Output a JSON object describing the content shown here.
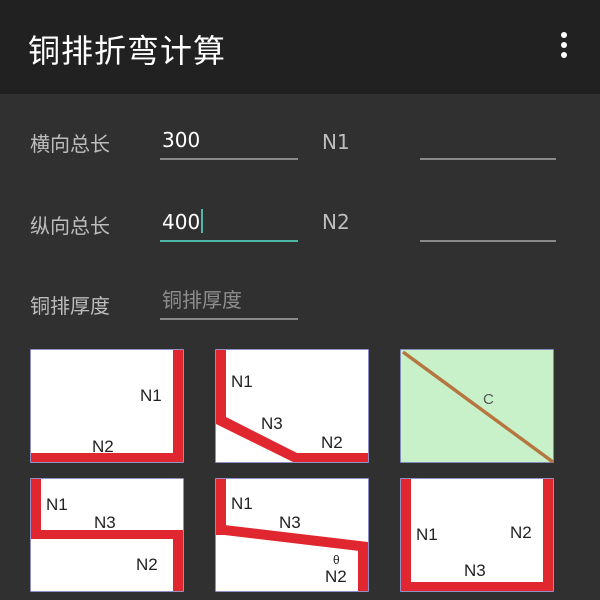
{
  "app": {
    "title": "铜排折弯计算"
  },
  "form": {
    "horizontal_length": {
      "label": "横向总长",
      "value": "300"
    },
    "vertical_length": {
      "label": "纵向总长",
      "value": "400"
    },
    "thickness": {
      "label": "铜排厚度",
      "value": "",
      "placeholder": "铜排厚度"
    },
    "n1": {
      "label": "N1",
      "value": ""
    },
    "n2": {
      "label": "N2",
      "value": ""
    }
  },
  "diagrams": [
    {
      "labels": {
        "a": "N1",
        "b": "N2"
      }
    },
    {
      "labels": {
        "a": "N1",
        "b": "N3",
        "c": "N2"
      }
    },
    {
      "labels": {
        "a": "C"
      }
    },
    {
      "labels": {
        "a": "N1",
        "b": "N3",
        "c": "N2"
      }
    },
    {
      "labels": {
        "a": "N1",
        "b": "N3",
        "c": "θ",
        "d": "N2"
      }
    },
    {
      "labels": {
        "a": "N1",
        "b": "N2",
        "c": "N3"
      }
    }
  ],
  "colors": {
    "appbar": "#212121",
    "background": "#303030",
    "accent": "#4fb7a8",
    "bar": "#e0262e",
    "diagonal": "#b5773f",
    "diagonal_bg": "#c9f1c9"
  }
}
